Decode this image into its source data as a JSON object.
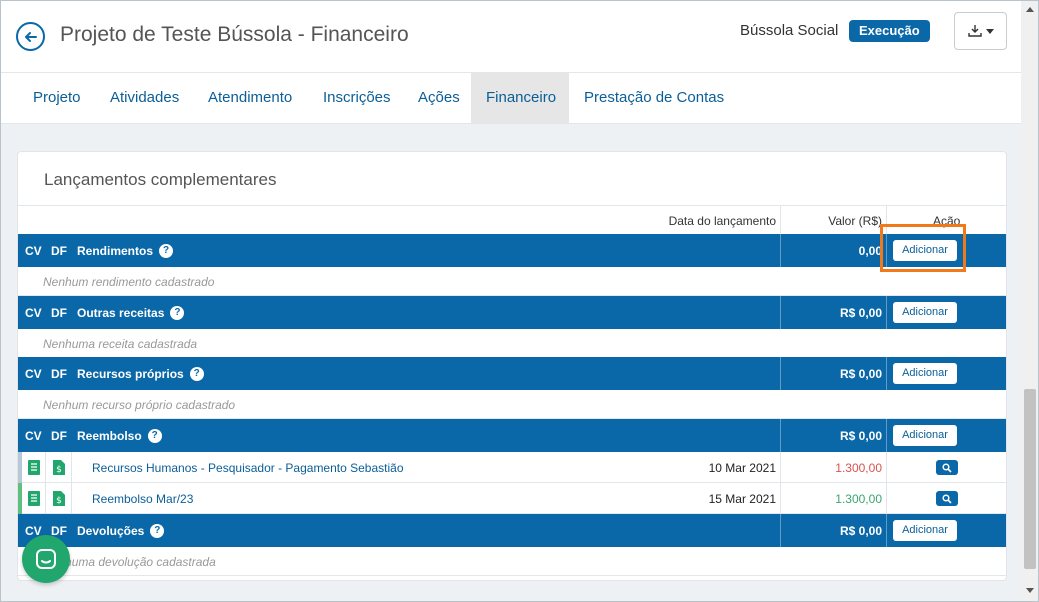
{
  "header": {
    "title": "Projeto de Teste Bússola - Financeiro",
    "org": "Bússola Social",
    "status_badge": "Execução"
  },
  "tabs": [
    {
      "label": "Projeto"
    },
    {
      "label": "Atividades"
    },
    {
      "label": "Atendimento"
    },
    {
      "label": "Inscrições"
    },
    {
      "label": "Ações"
    },
    {
      "label": "Financeiro",
      "active": true
    },
    {
      "label": "Prestação de Contas"
    }
  ],
  "card": {
    "title": "Lançamentos complementares",
    "columns": {
      "date": "Data do lançamento",
      "value": "Valor (R$)",
      "action": "Ação"
    },
    "cv": "CV",
    "df": "DF",
    "qm": "?",
    "add_label": "Adicionar",
    "groups": [
      {
        "label": "Rendimentos",
        "total": "0,00",
        "empty": "Nenhum rendimento cadastrado"
      },
      {
        "label": "Outras receitas",
        "total": "R$ 0,00",
        "empty": "Nenhuma receita cadastrada"
      },
      {
        "label": "Recursos próprios",
        "total": "R$ 0,00",
        "empty": "Nenhum recurso próprio cadastrado"
      },
      {
        "label": "Reembolso",
        "total": "R$ 0,00"
      },
      {
        "label": "Devoluções",
        "total": "R$ 0,00",
        "empty": "Nenhuma devolução cadastrada"
      }
    ],
    "reembolso_rows": [
      {
        "description": "Recursos Humanos - Pesquisador - Pagamento Sebastião",
        "date": "10 Mar 2021",
        "value": "1.300,00",
        "value_color": "#d9534f"
      },
      {
        "description": "Reembolso Mar/23",
        "date": "15 Mar 2021",
        "value": "1.300,00",
        "value_color": "#3aa76d"
      }
    ]
  },
  "colors": {
    "primary": "#0b68a8",
    "highlight": "#f07a1a",
    "chat": "#21a66e"
  }
}
